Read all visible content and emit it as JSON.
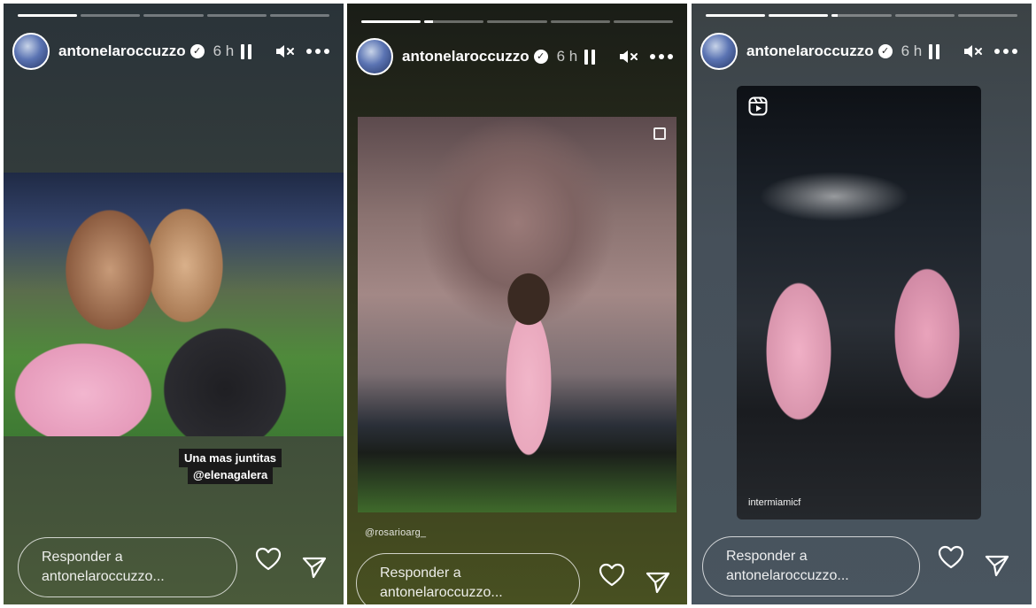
{
  "stories": [
    {
      "username": "antonelaroccuzzo",
      "time": "6 h",
      "caption_lines": [
        "Una mas juntitas",
        "@elenagalera"
      ],
      "reply_line1": "Responder a",
      "reply_line2": "antonelaroccuzzo...",
      "progress": [
        1,
        0,
        0,
        0,
        0
      ]
    },
    {
      "username": "antonelaroccuzzo",
      "time": "6 h",
      "tag": "@rosarioarg_",
      "reply_line1": "Responder a",
      "reply_line2": "antonelaroccuzzo...",
      "progress": [
        1,
        0.15,
        0,
        0,
        0
      ]
    },
    {
      "username": "antonelaroccuzzo",
      "time": "6 h",
      "reel_account": "intermiamicf",
      "reply_line1": "Responder a",
      "reply_line2": "antonelaroccuzzo...",
      "progress": [
        1,
        1,
        0.1,
        0,
        0
      ]
    }
  ],
  "icons": {
    "verified": "verified-check-icon",
    "pause": "pause-icon",
    "mute": "speaker-muted-icon",
    "more": "more-dots-icon",
    "like": "heart-icon",
    "share": "send-icon"
  },
  "colors": {
    "text": "#ffffff"
  }
}
